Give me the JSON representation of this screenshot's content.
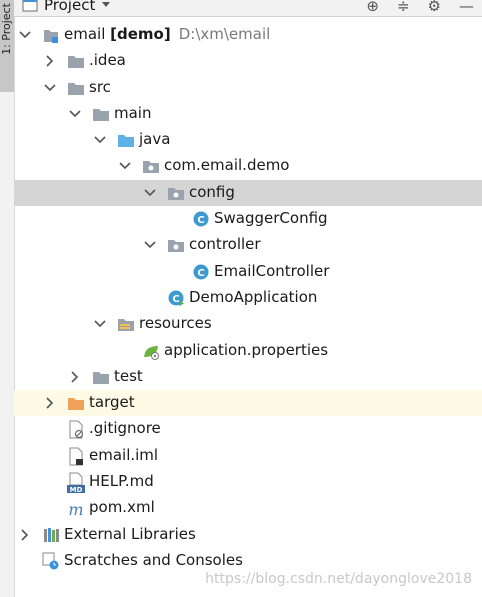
{
  "sidebar_tab": {
    "label": "1: Project"
  },
  "toolbar": {
    "title": "Project"
  },
  "tree": [
    {
      "name": "email",
      "badge": "[demo]",
      "path": "D:\\xm\\email",
      "indent": 0,
      "arrow": "down",
      "icon": "module"
    },
    {
      "name": ".idea",
      "indent": 1,
      "arrow": "right",
      "icon": "folder"
    },
    {
      "name": "src",
      "indent": 1,
      "arrow": "down",
      "icon": "folder"
    },
    {
      "name": "main",
      "indent": 2,
      "arrow": "down",
      "icon": "folder"
    },
    {
      "name": "java",
      "indent": 3,
      "arrow": "down",
      "icon": "folder-src"
    },
    {
      "name": "com.email.demo",
      "indent": 4,
      "arrow": "down",
      "icon": "package"
    },
    {
      "name": "config",
      "indent": 5,
      "arrow": "down",
      "icon": "package",
      "selected": true
    },
    {
      "name": "SwaggerConfig",
      "indent": 6,
      "arrow": "none",
      "icon": "class"
    },
    {
      "name": "controller",
      "indent": 5,
      "arrow": "down",
      "icon": "package"
    },
    {
      "name": "EmailController",
      "indent": 6,
      "arrow": "none",
      "icon": "class"
    },
    {
      "name": "DemoApplication",
      "indent": 5,
      "arrow": "none",
      "icon": "spring-class"
    },
    {
      "name": "resources",
      "indent": 3,
      "arrow": "down",
      "icon": "folder-res"
    },
    {
      "name": "application.properties",
      "indent": 4,
      "arrow": "none",
      "icon": "properties"
    },
    {
      "name": "test",
      "indent": 2,
      "arrow": "right",
      "icon": "folder"
    },
    {
      "name": "target",
      "indent": 1,
      "arrow": "right",
      "icon": "folder-excluded",
      "highlight": true
    },
    {
      "name": ".gitignore",
      "indent": 1,
      "arrow": "none",
      "icon": "ignore-file"
    },
    {
      "name": "email.iml",
      "indent": 1,
      "arrow": "none",
      "icon": "iml-file"
    },
    {
      "name": "HELP.md",
      "indent": 1,
      "arrow": "none",
      "icon": "markdown-file"
    },
    {
      "name": "pom.xml",
      "indent": 1,
      "arrow": "none",
      "icon": "maven-file"
    },
    {
      "name": "External Libraries",
      "indent": 0,
      "arrow": "right",
      "icon": "libraries"
    },
    {
      "name": "Scratches and Consoles",
      "indent": 0,
      "arrow": "none",
      "icon": "scratches"
    }
  ],
  "watermark": "https://blog.csdn.net/dayonglove2018"
}
